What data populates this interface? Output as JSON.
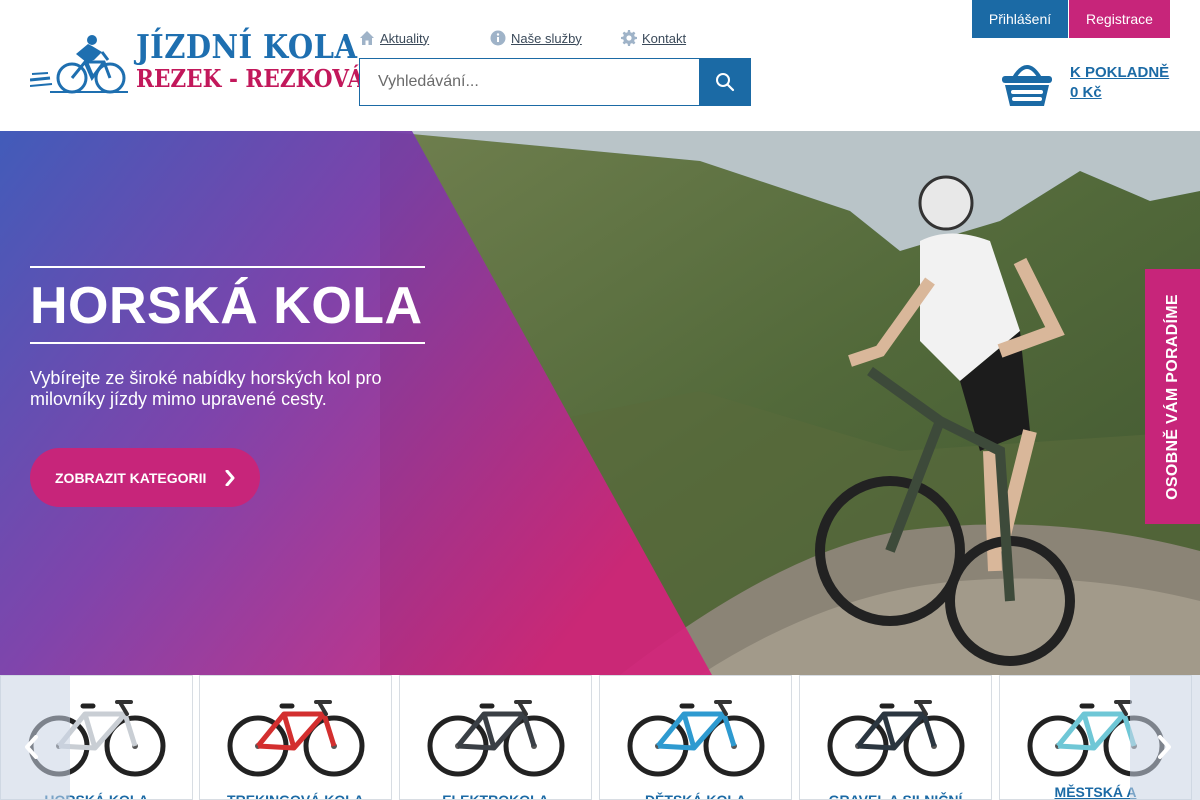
{
  "brand": {
    "line1": "JÍZDNÍ KOLA",
    "line2": "REZEK - REZKOVÁ",
    "color_primary": "#1e6fb0",
    "color_secondary": "#c2185b"
  },
  "topnav": [
    {
      "label": "Aktuality",
      "icon": "home-icon"
    },
    {
      "label": "Naše služby",
      "icon": "info-icon"
    },
    {
      "label": "Kontakt",
      "icon": "gear-icon"
    }
  ],
  "search": {
    "placeholder": "Vyhledávání...",
    "value": ""
  },
  "account": {
    "login_label": "Přihlášení",
    "register_label": "Registrace"
  },
  "cart": {
    "label": "K POKLADNĚ",
    "total": "0 Kč"
  },
  "hero": {
    "title": "HORSKÁ KOLA",
    "subtitle": "Vybírejte ze široké nabídky horských kol pro milovníky jízdy mimo upravené cesty.",
    "cta_label": "ZOBRAZIT KATEGORII"
  },
  "advise_tab": {
    "label": "OSOBNĚ VÁM PORADÍME"
  },
  "categories": [
    {
      "label": "HORSKÁ KOLA",
      "frame_color": "#c9ced4"
    },
    {
      "label": "TREKINGOVÁ KOLA",
      "frame_color": "#d32f2f"
    },
    {
      "label": "ELEKTROKOLA",
      "frame_color": "#3a3f45"
    },
    {
      "label": "DĚTSKÁ KOLA",
      "frame_color": "#2e9ad0"
    },
    {
      "label": "GRAVEL A SILNIČNÍ",
      "frame_color": "#2b3640"
    },
    {
      "label": "MĚSTSKÁ A",
      "frame_color": "#6fc7d6"
    }
  ],
  "colors": {
    "blue": "#1b6aa5",
    "magenta": "#c7257a"
  }
}
